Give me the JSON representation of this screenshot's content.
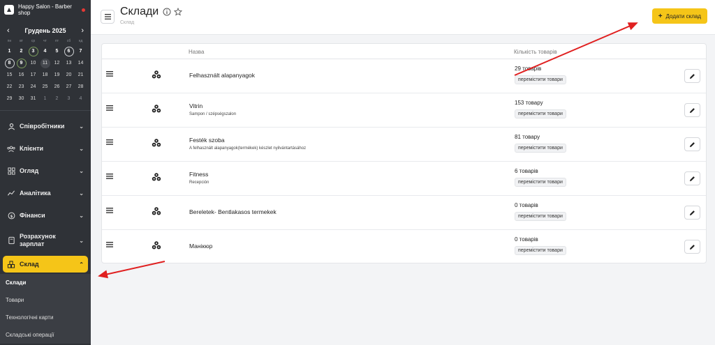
{
  "brand": {
    "name": "Happy Salon - Barber shop"
  },
  "calendar": {
    "month": "Грудень 2025",
    "weekdays": [
      "пн",
      "вт",
      "ср",
      "чт",
      "пт",
      "сб",
      "нд"
    ],
    "weeks": [
      [
        "1",
        "2",
        "3",
        "4",
        "5",
        "6",
        "7"
      ],
      [
        "8",
        "9",
        "10",
        "11",
        "12",
        "13",
        "14"
      ],
      [
        "15",
        "16",
        "17",
        "18",
        "19",
        "20",
        "21"
      ],
      [
        "22",
        "23",
        "24",
        "25",
        "26",
        "27",
        "28"
      ],
      [
        "29",
        "30",
        "31",
        "1",
        "2",
        "3",
        "4"
      ]
    ]
  },
  "menu": {
    "employees": "Співробітники",
    "clients": "Клієнти",
    "overview": "Огляд",
    "analytics": "Аналітика",
    "finance": "Фінанси",
    "payroll": "Розрахунок зарплат",
    "warehouse": "Склад",
    "submenu": [
      "Склади",
      "Товари",
      "Технологічні карти",
      "Складські операції"
    ]
  },
  "header": {
    "title": "Склади",
    "breadcrumb": "Склад",
    "add_button": "Додати склад"
  },
  "table": {
    "col_name": "Назва",
    "col_qty": "Кількість товарів",
    "move_label": "перемістити товари",
    "rows": [
      {
        "name": "Felhasznált alapanyagok",
        "sub": "",
        "qty": "29 товарів"
      },
      {
        "name": "Vitrin",
        "sub": "Sampon / szépségszalon",
        "qty": "153 товару"
      },
      {
        "name": "Festék szoba",
        "sub": "A felhasznált alapanyagok(termékek) készlet nyilvántartásához",
        "qty": "81 товару"
      },
      {
        "name": "Fitness",
        "sub": "Recepción",
        "qty": "6 товарів"
      },
      {
        "name": "Bereletek- Bentlakasos termekek",
        "sub": "",
        "qty": "0 товарів"
      },
      {
        "name": "Манікюр",
        "sub": "",
        "qty": "0 товарів"
      }
    ]
  },
  "colors": {
    "accent": "#f5c518",
    "sidebar": "#2f3237",
    "annotation_arrow": "#e02020"
  }
}
